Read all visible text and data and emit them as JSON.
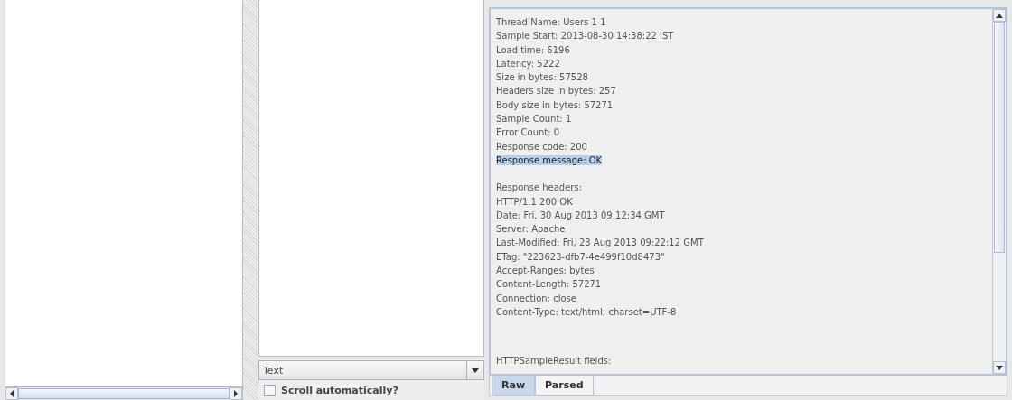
{
  "response_blocks": [
    {
      "lines": [
        {
          "text": "Thread Name: Users 1-1",
          "selected": false
        },
        {
          "text": "Sample Start: 2013-08-30 14:38:22 IST",
          "selected": false
        },
        {
          "text": "Load time: 6196",
          "selected": false
        },
        {
          "text": "Latency: 5222",
          "selected": false
        },
        {
          "text": "Size in bytes: 57528",
          "selected": false
        },
        {
          "text": "Headers size in bytes: 257",
          "selected": false
        },
        {
          "text": "Body size in bytes: 57271",
          "selected": false
        },
        {
          "text": "Sample Count: 1",
          "selected": false
        },
        {
          "text": "Error Count: 0",
          "selected": false
        },
        {
          "text": "Response code: 200",
          "selected": false
        },
        {
          "text": "Response message: OK",
          "selected": true
        }
      ]
    },
    {
      "lines": [
        {
          "text": "Response headers:",
          "selected": false
        },
        {
          "text": "HTTP/1.1 200 OK",
          "selected": false
        },
        {
          "text": "Date: Fri, 30 Aug 2013 09:12:34 GMT",
          "selected": false
        },
        {
          "text": "Server: Apache",
          "selected": false
        },
        {
          "text": "Last-Modified: Fri, 23 Aug 2013 09:22:12 GMT",
          "selected": false
        },
        {
          "text": "ETag: \"223623-dfb7-4e499f10d8473\"",
          "selected": false
        },
        {
          "text": "Accept-Ranges: bytes",
          "selected": false
        },
        {
          "text": "Content-Length: 57271",
          "selected": false
        },
        {
          "text": "Connection: close",
          "selected": false
        },
        {
          "text": "Content-Type: text/html; charset=UTF-8",
          "selected": false
        }
      ]
    },
    {
      "lines": [
        {
          "text": "HTTPSampleResult fields:",
          "selected": false
        }
      ]
    }
  ],
  "render_select": {
    "value": "Text"
  },
  "scroll_checkbox": {
    "label": "Scroll automatically?",
    "checked": false
  },
  "view_tabs": [
    {
      "label": "Raw",
      "selected": true
    },
    {
      "label": "Parsed",
      "selected": false
    }
  ]
}
